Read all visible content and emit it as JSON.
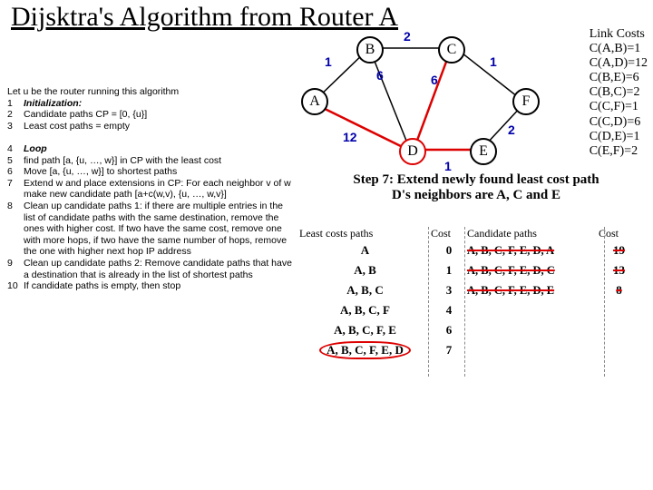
{
  "title": "Dijsktra's Algorithm from Router A",
  "linkcosts": {
    "header": "Link Costs",
    "items": [
      "C(A,B)=1",
      "C(A,D)=12",
      "C(B,E)=6",
      "C(B,C)=2",
      "C(C,F)=1",
      "C(C,D)=6",
      "C(D,E)=1",
      "C(E,F)=2"
    ]
  },
  "algo": {
    "intro": "Let u be the router running this algorithm",
    "lines": [
      {
        "n": "1",
        "t": "Initialization:",
        "b": true
      },
      {
        "n": "2",
        "t": "Candidate paths CP = [0, {u}]"
      },
      {
        "n": "3",
        "t": "Least cost paths = empty"
      },
      {
        "n": "",
        "t": ""
      },
      {
        "n": "4",
        "t": "Loop",
        "b": true
      },
      {
        "n": "5",
        "t": "find path [a, {u, …, w}] in CP with the least cost"
      },
      {
        "n": "6",
        "t": "Move [a, {u, …, w}] to shortest paths"
      },
      {
        "n": "7",
        "t": "Extend w and place extensions in CP: For each neighbor v of w make new candidate path [a+c(w,v), {u, …, w,v}]"
      },
      {
        "n": "8",
        "t": "Clean up candidate paths 1: if there are multiple entries in the list of candidate paths with the same destination, remove the ones with higher cost. If two have the same cost, remove one with more hops, if two have the same number of hops, remove the one with higher next hop IP address"
      },
      {
        "n": "9",
        "t": "Clean up candidate paths 2: Remove candidate paths that have a destination that is already in the list of shortest paths"
      },
      {
        "n": "10",
        "t": "If candidate paths is empty, then stop"
      }
    ]
  },
  "graph": {
    "nodes": {
      "A": "A",
      "B": "B",
      "C": "C",
      "D": "D",
      "E": "E",
      "F": "F"
    },
    "weights": {
      "AB": "1",
      "AD": "12",
      "BE": "6",
      "BC": "2",
      "CD": "6",
      "CF": "1",
      "DE": "1",
      "EF": "2"
    }
  },
  "step": {
    "line1": "Step 7: Extend newly found least cost path",
    "line2": "D's neighbors are A, C and E"
  },
  "tables": {
    "h1": "Least costs paths",
    "h2": "Cost",
    "h3": "Candidate paths",
    "h4": "Cost",
    "left": [
      {
        "p": "A",
        "c": "0"
      },
      {
        "p": "A, B",
        "c": "1"
      },
      {
        "p": "A, B, C",
        "c": "3"
      },
      {
        "p": "A, B, C, F",
        "c": "4"
      },
      {
        "p": "A, B, C, F, E",
        "c": "6"
      },
      {
        "p": "A, B, C, F, E, D",
        "c": "7"
      }
    ],
    "right": [
      {
        "p": "A, B, C, F, E, D, A",
        "c": "19",
        "strike": true
      },
      {
        "p": "A, B, C, F, E, D, C",
        "c": "13",
        "strike": true
      },
      {
        "p": "A, B, C, F, E, D, E",
        "c": "8",
        "strike": true
      }
    ]
  },
  "chart_data": {
    "type": "graph",
    "nodes": [
      "A",
      "B",
      "C",
      "D",
      "E",
      "F"
    ],
    "edges": [
      {
        "u": "A",
        "v": "B",
        "w": 1
      },
      {
        "u": "A",
        "v": "D",
        "w": 12
      },
      {
        "u": "B",
        "v": "E",
        "w": 6
      },
      {
        "u": "B",
        "v": "C",
        "w": 2
      },
      {
        "u": "C",
        "v": "D",
        "w": 6
      },
      {
        "u": "C",
        "v": "F",
        "w": 1
      },
      {
        "u": "D",
        "v": "E",
        "w": 1
      },
      {
        "u": "E",
        "v": "F",
        "w": 2
      }
    ],
    "source": "A",
    "current_extend": "D"
  }
}
